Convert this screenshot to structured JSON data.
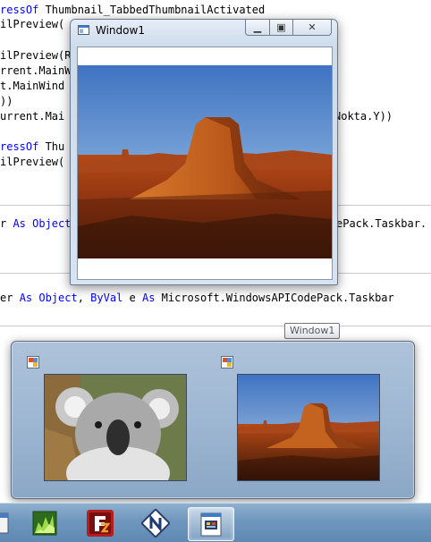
{
  "code_lines": [
    {
      "pre": "",
      "kw": "ressOf",
      "post": " Thumbnail_TabbedThumbnailActivated"
    },
    {
      "pre": "ilPreview(",
      "kw": "",
      "post": ""
    },
    {
      "pre": "",
      "kw": "",
      "post": ""
    },
    {
      "pre": "ilPreview(R",
      "kw": "",
      "post": ""
    },
    {
      "pre": "rrent.MainW",
      "kw": "",
      "post": ""
    },
    {
      "pre": "t.MainWind",
      "kw": "",
      "post": ""
    },
    {
      "pre": "))",
      "kw": "",
      "post": ""
    },
    {
      "pre": "urrent.Mai",
      "kw": "",
      "post": ""
    },
    {
      "pre": "",
      "kw": "",
      "post": ""
    },
    {
      "pre": "",
      "kw": "ressOf",
      "post": " Thu"
    },
    {
      "pre": "ilPreview(",
      "kw": "",
      "post": ""
    }
  ],
  "code_fragment_right": "Nokta.Y))",
  "code_line_12": {
    "pre": "r ",
    "kw": "As Object",
    "post": "",
    "right": "ePack.Taskbar."
  },
  "code_line_14": {
    "pre": "er ",
    "kw1": "As Object",
    "mid": ", ",
    "kw2": "ByVal",
    "mid2": " e ",
    "kw3": "As",
    "post": " Microsoft.WindowsAPICodePack.Taskbar"
  },
  "window": {
    "title": "Window1",
    "min_glyph": "▁",
    "max_glyph": "▣",
    "close_glyph": "✕"
  },
  "tooltip": "Window1",
  "taskbar": {
    "items": [
      "unknown-app",
      "green-app",
      "filezilla",
      "nvu",
      "wpf-app"
    ]
  },
  "colors": {
    "keyword": "#0000ff",
    "taskbar": "#6f96bd",
    "flyout": "#9ab4d0"
  }
}
